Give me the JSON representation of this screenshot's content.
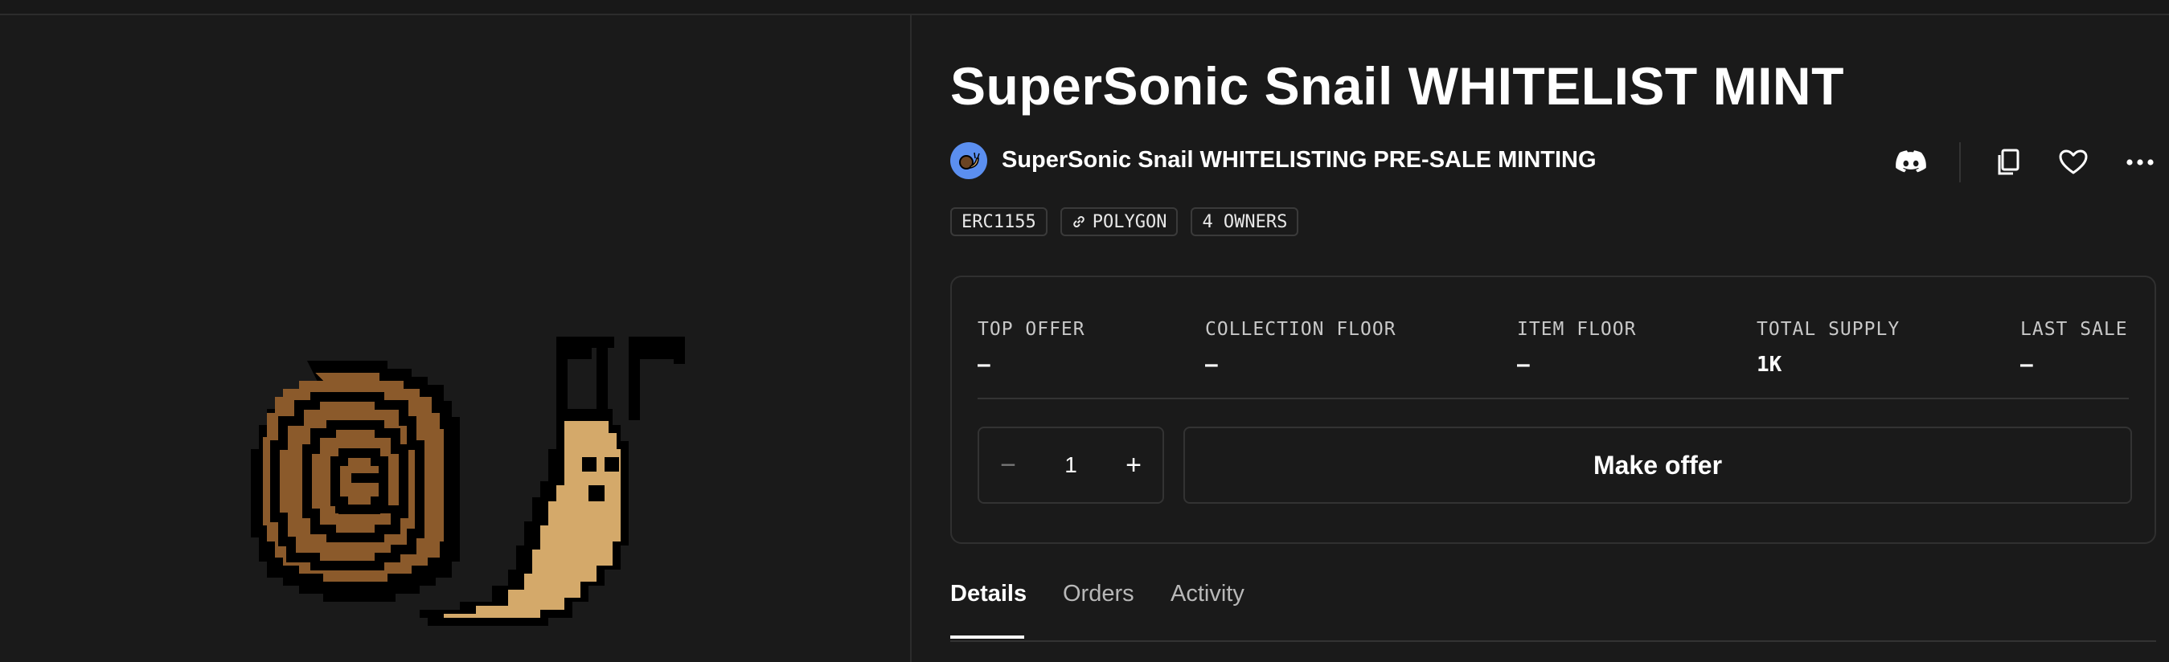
{
  "title": "SuperSonic Snail WHITELIST MINT",
  "collection": {
    "name": "SuperSonic Snail WHITELISTING PRE-SALE MINTING"
  },
  "actions": [
    {
      "icon": "discord-icon"
    },
    {
      "icon": "copy-icon"
    },
    {
      "icon": "heart-icon"
    },
    {
      "icon": "more-icon"
    }
  ],
  "tags": {
    "standard": "ERC1155",
    "chain": "POLYGON",
    "owners": "4 OWNERS"
  },
  "stats": [
    {
      "label": "TOP OFFER",
      "value": "–"
    },
    {
      "label": "COLLECTION FLOOR",
      "value": "–"
    },
    {
      "label": "ITEM FLOOR",
      "value": "–"
    },
    {
      "label": "TOTAL SUPPLY",
      "value": "1K"
    },
    {
      "label": "LAST SALE",
      "value": "–"
    }
  ],
  "quantity": {
    "minus": "−",
    "value": "1",
    "plus": "+"
  },
  "offer_button": "Make offer",
  "tabs": [
    "Details",
    "Orders",
    "Activity"
  ],
  "colors": {
    "background": "#1a1a1a",
    "shell": "#8b5a2b",
    "body": "#d4a96a",
    "avatar": "#5b8ff0"
  }
}
